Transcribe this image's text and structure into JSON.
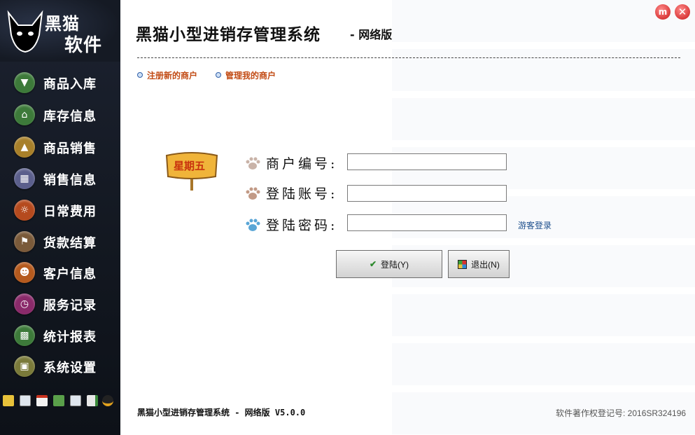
{
  "sidebar": {
    "logo": {
      "line1": "黑猫",
      "line2": "软件"
    },
    "items": [
      {
        "label": "商品入库",
        "icon": "download-arrow-icon",
        "color": "#3d7a3a"
      },
      {
        "label": "库存信息",
        "icon": "home-icon",
        "color": "#3d7a3a"
      },
      {
        "label": "商品销售",
        "icon": "up-arrow-icon",
        "color": "#a8802a"
      },
      {
        "label": "销售信息",
        "icon": "calculator-icon",
        "color": "#5b5f8c"
      },
      {
        "label": "日常费用",
        "icon": "sun-icon",
        "color": "#b54a1e"
      },
      {
        "label": "货款结算",
        "icon": "flag-icon",
        "color": "#7a5a3a"
      },
      {
        "label": "客户信息",
        "icon": "person-icon",
        "color": "#b55a1e"
      },
      {
        "label": "服务记录",
        "icon": "clock-icon",
        "color": "#8a2a6a"
      },
      {
        "label": "统计报表",
        "icon": "bar-chart-icon",
        "color": "#3d7a3a"
      },
      {
        "label": "系统设置",
        "icon": "monitor-icon",
        "color": "#7a7a3a"
      }
    ],
    "quick_icons": [
      "users-icon",
      "window-icon",
      "calendar-icon",
      "recycle-icon",
      "line-chart-icon",
      "export-icon",
      "qq-icon"
    ]
  },
  "header": {
    "title": "黑猫小型进销存管理系统",
    "subtitle": "- 网络版",
    "links": [
      "注册新的商户",
      "管理我的商户"
    ]
  },
  "window": {
    "minimize_label": "m",
    "close_label": "✕"
  },
  "sign": {
    "text": "星期五"
  },
  "form": {
    "merchant_label": "商户编号:",
    "account_label": "登陆账号:",
    "password_label": "登陆密码:",
    "merchant_value": "",
    "account_value": "",
    "password_value": "",
    "guest_login": "游客登录",
    "login_button": "登陆(Y)",
    "exit_button": "退出(N)"
  },
  "footer": {
    "left": "黑猫小型进销存管理系统 - 网络版 V5.0.0",
    "right": "软件著作权登记号: 2016SR324196"
  }
}
